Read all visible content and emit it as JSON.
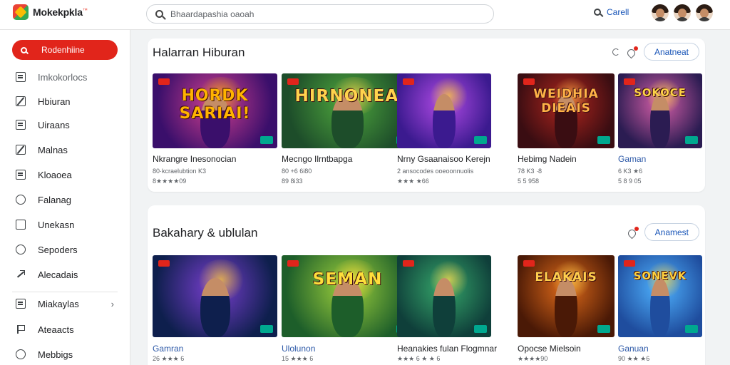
{
  "app": {
    "name": "Mokekpkla"
  },
  "search": {
    "placeholder": "Bhaardapashia oaoah"
  },
  "topbar": {
    "search_link": "Carell"
  },
  "colors": {
    "accent": "#e1251b",
    "link": "#1a56b8",
    "rating_badge": "#00a88f"
  },
  "sidebar": {
    "active": {
      "icon": "search-icon",
      "label": "Rodenhiine"
    },
    "items": [
      {
        "icon": "library-icon",
        "label": "Imkokorlocs",
        "muted": true
      },
      {
        "icon": "slash-icon",
        "label": "Hbiuran"
      },
      {
        "icon": "tray-icon",
        "label": "Uiraans"
      },
      {
        "icon": "no-entry-icon",
        "label": "Malnas"
      },
      {
        "icon": "inbox-icon",
        "label": "Kloaoea"
      },
      {
        "icon": "clock-icon",
        "label": "Falanag"
      },
      {
        "icon": "home-icon",
        "label": "Unekasn"
      },
      {
        "icon": "bag-icon",
        "label": "Sepoders"
      },
      {
        "icon": "share-icon",
        "label": "Alecadais"
      },
      {
        "icon": "folder-icon",
        "label": "Miakaylas",
        "chevron": "›"
      },
      {
        "icon": "flag-icon",
        "label": "Ateaacts"
      },
      {
        "icon": "history-icon",
        "label": "Mebbigs"
      }
    ]
  },
  "sections": [
    {
      "title": "Halarran Hiburan",
      "see_all": "Anatneat",
      "cards": [
        {
          "name": "Nkrangre Inesonocian",
          "meta1": "80·kcraelubtion K3",
          "meta2": "8★★★★09",
          "art": "HORDK SARIAI!",
          "palette": "purple"
        },
        {
          "name": "Mecngo Ilrntbapga",
          "meta1": "80 +6 6i80",
          "meta2": "89 8i33",
          "art": "HIRNONEAS",
          "palette": "green"
        },
        {
          "name": "Nrny Gsaanaisoo Kerejn",
          "meta1": "2 ansocodes ooeoonnuolis",
          "meta2": "★★★ ★66",
          "art": "",
          "palette": "violet"
        },
        {
          "name": "Hebimg  Nadein",
          "meta1": "78 K3 ·8",
          "meta2": "5 5 958",
          "art": "WEIDHIA DIEAIS",
          "palette": "red"
        },
        {
          "name": "Gaman",
          "meta1": "6 K3 ★6",
          "meta2": "5 8 9 05",
          "art": "SOKOCE",
          "palette": "pink",
          "blue_name": true
        }
      ]
    },
    {
      "title": "Bakahary & ublulan",
      "see_all": "Anamest",
      "cards": [
        {
          "name": "Gamran",
          "meta1": "26 ★★★ 6",
          "meta2": "",
          "art": "",
          "palette": "navy",
          "blue_name": true
        },
        {
          "name": "Ulolunon",
          "meta1": "15 ★★★ 6",
          "meta2": "",
          "art": "SEMAN",
          "palette": "lime",
          "blue_name": true
        },
        {
          "name": "Heanakies fulan Flogmnar",
          "meta1": "★★★ 6 ★ ★ 6",
          "meta2": "",
          "art": "",
          "palette": "teal"
        },
        {
          "name": "Opocse Mielsoin",
          "meta1": "★★★★90",
          "meta2": "",
          "art": "ELAKAIS",
          "palette": "orange"
        },
        {
          "name": "Ganuan",
          "meta1": "90 ★★ ★6",
          "meta2": "",
          "art": "SONEVK",
          "palette": "sky",
          "blue_name": true
        }
      ]
    }
  ]
}
